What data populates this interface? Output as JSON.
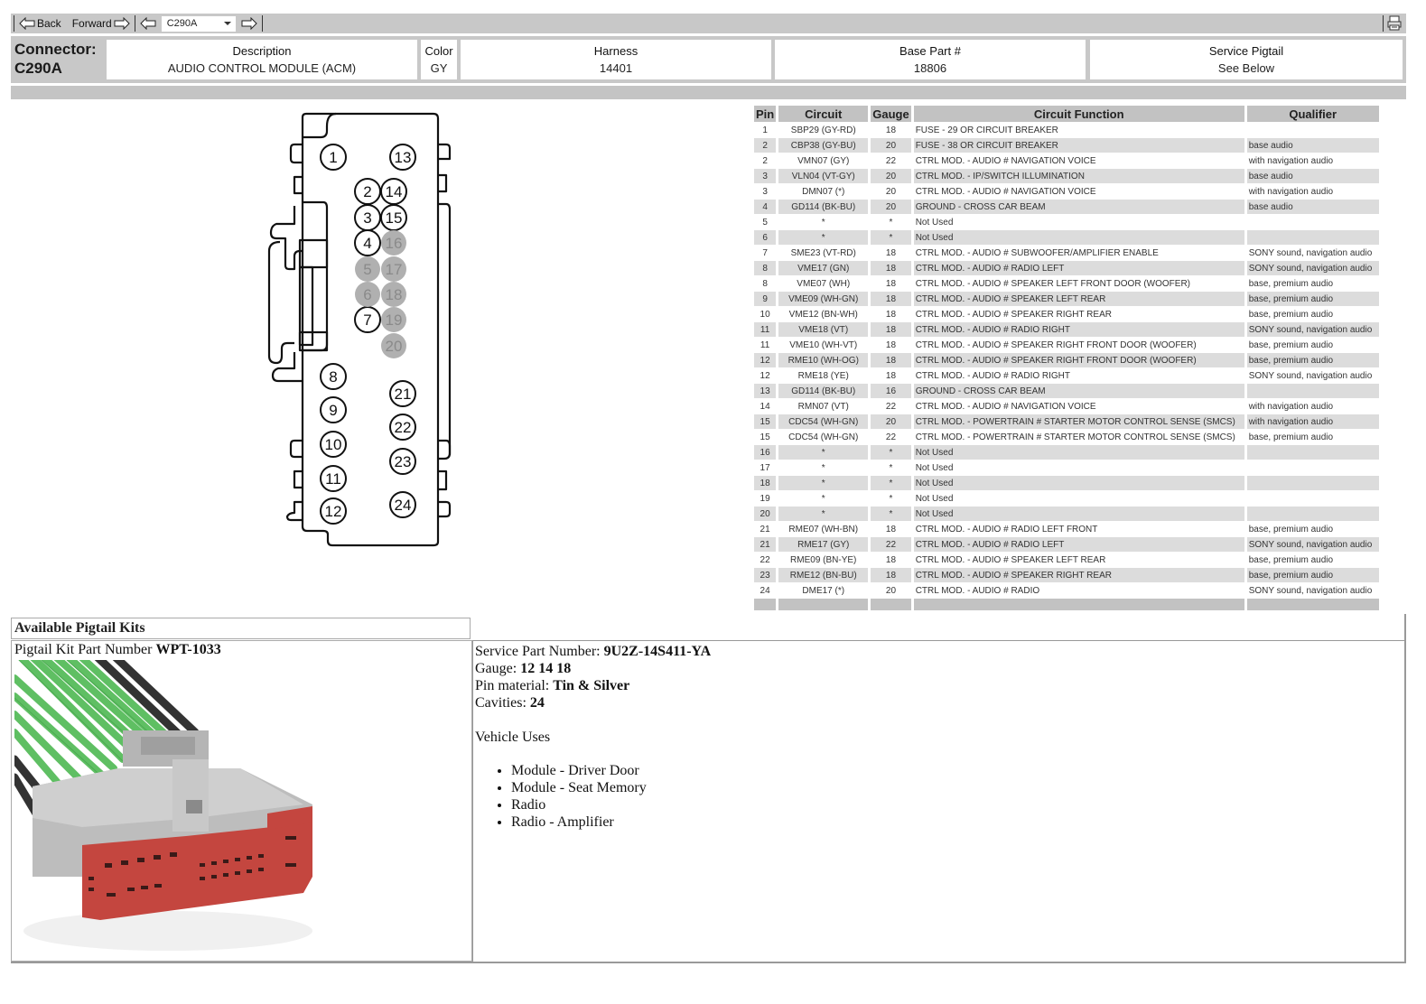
{
  "toolbar": {
    "back_label": "Back",
    "forward_label": "Forward",
    "connector_select_value": "C290A",
    "icons": {
      "back": "left-arrow-icon",
      "forward": "right-arrow-icon",
      "prev": "left-arrow-icon",
      "next": "right-arrow-icon",
      "print": "printer-icon"
    }
  },
  "header": {
    "connector_label": "Connector:",
    "connector_id": "C290A",
    "columns": [
      {
        "title": "Description",
        "value": "AUDIO CONTROL MODULE (ACM)"
      },
      {
        "title": "Color",
        "value": "GY"
      },
      {
        "title": "Harness",
        "value": "14401"
      },
      {
        "title": "Base Part #",
        "value": "18806"
      },
      {
        "title": "Service Pigtail",
        "value": "See Below"
      }
    ]
  },
  "diagram": {
    "open_pins": [
      "1",
      "13",
      "2",
      "14",
      "3",
      "15",
      "4",
      "7",
      "8",
      "9",
      "10",
      "11",
      "12",
      "21",
      "22",
      "23",
      "24"
    ],
    "unused_pins": [
      "16",
      "5",
      "17",
      "6",
      "18",
      "19",
      "20"
    ]
  },
  "pin_table": {
    "headers": [
      "Pin",
      "Circuit",
      "Gauge",
      "Circuit Function",
      "Qualifier"
    ],
    "rows": [
      {
        "pin": "1",
        "circuit": "SBP29 (GY-RD)",
        "gauge": "18",
        "function": "FUSE - 29 OR CIRCUIT BREAKER",
        "qualifier": ""
      },
      {
        "pin": "2",
        "circuit": "CBP38 (GY-BU)",
        "gauge": "20",
        "function": "FUSE - 38 OR CIRCUIT BREAKER",
        "qualifier": "base audio"
      },
      {
        "pin": "2",
        "circuit": "VMN07 (GY)",
        "gauge": "22",
        "function": "CTRL MOD. - AUDIO # NAVIGATION VOICE",
        "qualifier": "with navigation audio"
      },
      {
        "pin": "3",
        "circuit": "VLN04 (VT-GY)",
        "gauge": "20",
        "function": "CTRL MOD. - IP/SWITCH ILLUMINATION",
        "qualifier": "base audio"
      },
      {
        "pin": "3",
        "circuit": "DMN07 (*)",
        "gauge": "20",
        "function": "CTRL MOD. - AUDIO # NAVIGATION VOICE",
        "qualifier": "with navigation audio"
      },
      {
        "pin": "4",
        "circuit": "GD114 (BK-BU)",
        "gauge": "20",
        "function": "GROUND - CROSS CAR BEAM",
        "qualifier": "base audio"
      },
      {
        "pin": "5",
        "circuit": "*",
        "gauge": "*",
        "function": "Not Used",
        "qualifier": ""
      },
      {
        "pin": "6",
        "circuit": "*",
        "gauge": "*",
        "function": "Not Used",
        "qualifier": ""
      },
      {
        "pin": "7",
        "circuit": "SME23 (VT-RD)",
        "gauge": "18",
        "function": "CTRL MOD. - AUDIO # SUBWOOFER/AMPLIFIER ENABLE",
        "qualifier": "SONY sound, navigation audio"
      },
      {
        "pin": "8",
        "circuit": "VME17 (GN)",
        "gauge": "18",
        "function": "CTRL MOD. - AUDIO # RADIO LEFT",
        "qualifier": "SONY sound, navigation audio"
      },
      {
        "pin": "8",
        "circuit": "VME07 (WH)",
        "gauge": "18",
        "function": "CTRL MOD. - AUDIO # SPEAKER LEFT FRONT DOOR (WOOFER)",
        "qualifier": "base, premium audio"
      },
      {
        "pin": "9",
        "circuit": "VME09 (WH-GN)",
        "gauge": "18",
        "function": "CTRL MOD. - AUDIO # SPEAKER LEFT REAR",
        "qualifier": "base, premium audio"
      },
      {
        "pin": "10",
        "circuit": "VME12 (BN-WH)",
        "gauge": "18",
        "function": "CTRL MOD. - AUDIO # SPEAKER RIGHT REAR",
        "qualifier": "base, premium audio"
      },
      {
        "pin": "11",
        "circuit": "VME18 (VT)",
        "gauge": "18",
        "function": "CTRL MOD. - AUDIO # RADIO RIGHT",
        "qualifier": "SONY sound, navigation audio"
      },
      {
        "pin": "11",
        "circuit": "VME10 (WH-VT)",
        "gauge": "18",
        "function": "CTRL MOD. - AUDIO # SPEAKER RIGHT FRONT DOOR (WOOFER)",
        "qualifier": "base, premium audio"
      },
      {
        "pin": "12",
        "circuit": "RME10 (WH-OG)",
        "gauge": "18",
        "function": "CTRL MOD. - AUDIO # SPEAKER RIGHT FRONT DOOR (WOOFER)",
        "qualifier": "base, premium audio"
      },
      {
        "pin": "12",
        "circuit": "RME18 (YE)",
        "gauge": "18",
        "function": "CTRL MOD. - AUDIO # RADIO RIGHT",
        "qualifier": "SONY sound, navigation audio"
      },
      {
        "pin": "13",
        "circuit": "GD114 (BK-BU)",
        "gauge": "16",
        "function": "GROUND - CROSS CAR BEAM",
        "qualifier": ""
      },
      {
        "pin": "14",
        "circuit": "RMN07 (VT)",
        "gauge": "22",
        "function": "CTRL MOD. - AUDIO # NAVIGATION VOICE",
        "qualifier": "with navigation audio"
      },
      {
        "pin": "15",
        "circuit": "CDC54 (WH-GN)",
        "gauge": "20",
        "function": "CTRL MOD. - POWERTRAIN # STARTER MOTOR CONTROL SENSE (SMCS)",
        "qualifier": "with navigation audio"
      },
      {
        "pin": "15",
        "circuit": "CDC54 (WH-GN)",
        "gauge": "22",
        "function": "CTRL MOD. - POWERTRAIN # STARTER MOTOR CONTROL SENSE (SMCS)",
        "qualifier": "base, premium audio"
      },
      {
        "pin": "16",
        "circuit": "*",
        "gauge": "*",
        "function": "Not Used",
        "qualifier": ""
      },
      {
        "pin": "17",
        "circuit": "*",
        "gauge": "*",
        "function": "Not Used",
        "qualifier": ""
      },
      {
        "pin": "18",
        "circuit": "*",
        "gauge": "*",
        "function": "Not Used",
        "qualifier": ""
      },
      {
        "pin": "19",
        "circuit": "*",
        "gauge": "*",
        "function": "Not Used",
        "qualifier": ""
      },
      {
        "pin": "20",
        "circuit": "*",
        "gauge": "*",
        "function": "Not Used",
        "qualifier": ""
      },
      {
        "pin": "21",
        "circuit": "RME07 (WH-BN)",
        "gauge": "18",
        "function": "CTRL MOD. - AUDIO # RADIO LEFT FRONT",
        "qualifier": "base, premium audio"
      },
      {
        "pin": "21",
        "circuit": "RME17 (GY)",
        "gauge": "22",
        "function": "CTRL MOD. - AUDIO # RADIO LEFT",
        "qualifier": "SONY sound, navigation audio"
      },
      {
        "pin": "22",
        "circuit": "RME09 (BN-YE)",
        "gauge": "18",
        "function": "CTRL MOD. - AUDIO # SPEAKER LEFT REAR",
        "qualifier": "base, premium audio"
      },
      {
        "pin": "23",
        "circuit": "RME12 (BN-BU)",
        "gauge": "18",
        "function": "CTRL MOD. - AUDIO # SPEAKER RIGHT REAR",
        "qualifier": "base, premium audio"
      },
      {
        "pin": "24",
        "circuit": "DME17 (*)",
        "gauge": "20",
        "function": "CTRL MOD. - AUDIO # RADIO",
        "qualifier": "SONY sound, navigation audio"
      }
    ]
  },
  "pigtail": {
    "section_title": "Available Pigtail Kits",
    "kit_label": "Pigtail Kit Part Number",
    "kit_number": "WPT-1033",
    "photo_alt": "pigtail-connector-photo",
    "details": [
      {
        "label": "Service Part Number:",
        "value": "9U2Z-14S411-YA"
      },
      {
        "label": "Gauge:",
        "value": "12 14 18"
      },
      {
        "label": "Pin material:",
        "value": "Tin & Silver"
      },
      {
        "label": "Cavities:",
        "value": "24"
      }
    ],
    "vehicle_uses_title": "Vehicle Uses",
    "vehicle_uses": [
      "Module - Driver Door",
      "Module - Seat Memory",
      "Radio",
      "Radio - Amplifier"
    ]
  },
  "colors": {
    "toolbar_bg": "#c8c8c8",
    "header_bg": "#c8c8c8",
    "table_header_bg": "#c2c2c2",
    "row_alt_bg": "#dcdcdc",
    "unused_pin_fill": "#b0b0b0",
    "pigtail_housing": "#c4463f",
    "pigtail_wire": "#5fbf63"
  }
}
